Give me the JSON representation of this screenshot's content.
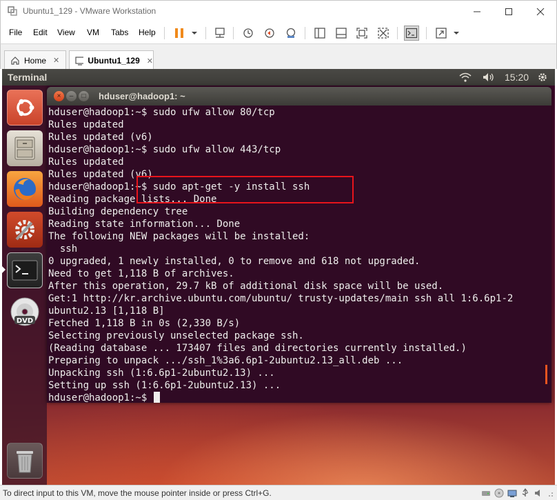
{
  "window": {
    "title": "Ubuntu1_129 - VMware Workstation"
  },
  "menubar": {
    "items": [
      "File",
      "Edit",
      "View",
      "VM",
      "Tabs",
      "Help"
    ]
  },
  "tabs": [
    {
      "label": "Home",
      "active": false
    },
    {
      "label": "Ubuntu1_129",
      "active": true
    }
  ],
  "tab_close_glyph": "✕",
  "guest": {
    "panel_title": "Terminal",
    "clock": "15:20",
    "launcher_items": [
      "ubuntu-dash",
      "files",
      "firefox",
      "system-settings",
      "terminal",
      "dvd",
      "trash"
    ],
    "terminal": {
      "title": "hduser@hadoop1: ~",
      "lines": [
        "hduser@hadoop1:~$ sudo ufw allow 80/tcp",
        "Rules updated",
        "Rules updated (v6)",
        "hduser@hadoop1:~$ sudo ufw allow 443/tcp",
        "Rules updated",
        "Rules updated (v6)",
        "hduser@hadoop1:~$ sudo apt-get -y install ssh",
        "Reading package lists... Done",
        "Building dependency tree",
        "Reading state information... Done",
        "The following NEW packages will be installed:",
        "  ssh",
        "0 upgraded, 1 newly installed, 0 to remove and 618 not upgraded.",
        "Need to get 1,118 B of archives.",
        "After this operation, 29.7 kB of additional disk space will be used.",
        "Get:1 http://kr.archive.ubuntu.com/ubuntu/ trusty-updates/main ssh all 1:6.6p1-2",
        "ubuntu2.13 [1,118 B]",
        "Fetched 1,118 B in 0s (2,330 B/s)",
        "Selecting previously unselected package ssh.",
        "(Reading database ... 173407 files and directories currently installed.)",
        "Preparing to unpack .../ssh_1%3a6.6p1-2ubuntu2.13_all.deb ...",
        "Unpacking ssh (1:6.6p1-2ubuntu2.13) ...",
        "Setting up ssh (1:6.6p1-2ubuntu2.13) ...",
        "hduser@hadoop1:~$ "
      ]
    }
  },
  "statusbar": {
    "text": "To direct input to this VM, move the mouse pointer inside or press Ctrl+G."
  },
  "colors": {
    "terminal_bg": "#300a24",
    "terminal_fg": "#eeeeec",
    "highlight": "#e8141b",
    "ubuntu_orange": "#e95420"
  }
}
